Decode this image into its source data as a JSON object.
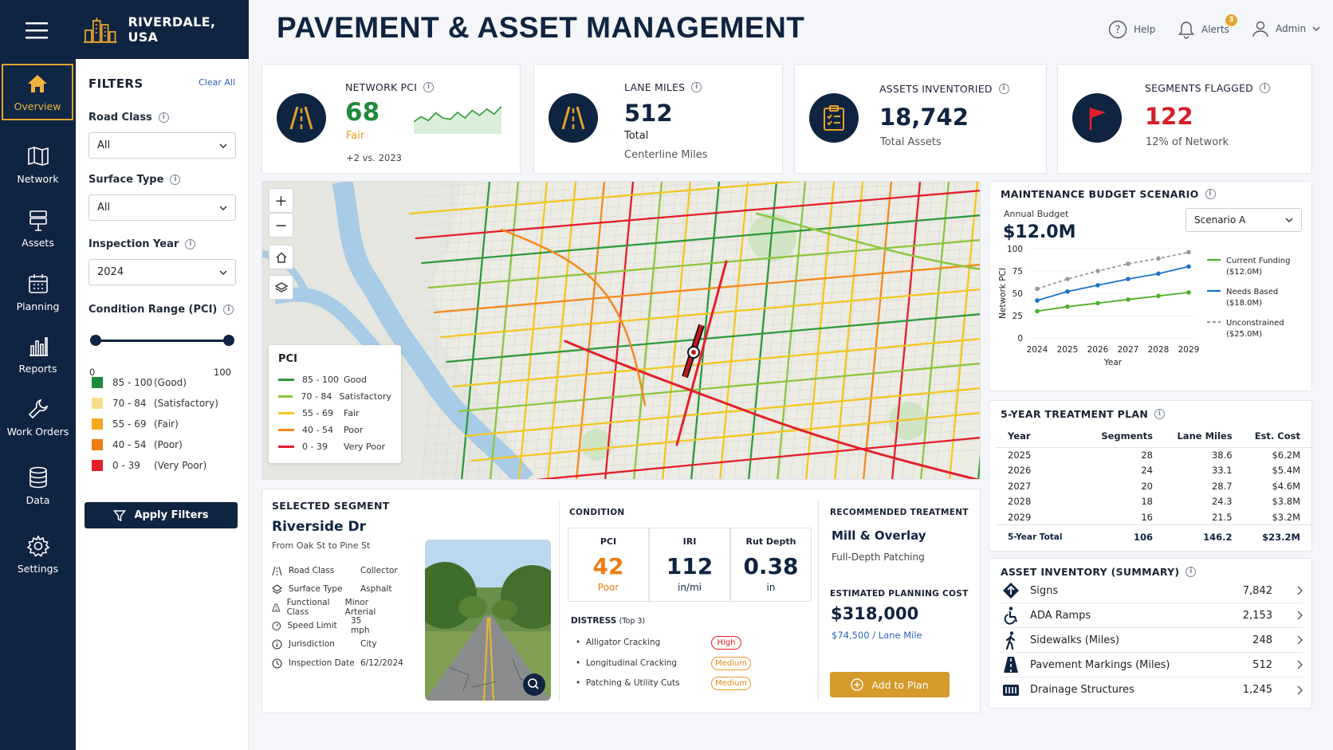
{
  "app": {
    "city": "RIVERDALE, USA",
    "title": "PAVEMENT & ASSET MANAGEMENT"
  },
  "topbar": {
    "help": "Help",
    "alerts": "Alerts",
    "alerts_count": "3",
    "user": "Admin"
  },
  "nav": [
    {
      "label": "Overview",
      "icon": "home-icon",
      "active": true
    },
    {
      "label": "Network",
      "icon": "map-icon"
    },
    {
      "label": "Assets",
      "icon": "road-sign-icon"
    },
    {
      "label": "Planning",
      "icon": "calendar-icon"
    },
    {
      "label": "Reports",
      "icon": "bar-chart-icon"
    },
    {
      "label": "Work Orders",
      "icon": "wrench-icon"
    },
    {
      "label": "Data",
      "icon": "database-icon"
    },
    {
      "label": "Settings",
      "icon": "gear-icon"
    }
  ],
  "filters": {
    "title": "FILTERS",
    "clear": "Clear All",
    "road_class": {
      "label": "Road Class",
      "value": "All"
    },
    "surface_type": {
      "label": "Surface Type",
      "value": "All"
    },
    "inspection_year": {
      "label": "Inspection Year",
      "value": "2024"
    },
    "condition_range": {
      "label": "Condition Range (PCI)",
      "min": "0",
      "max": "100"
    },
    "legend": [
      {
        "range": "85 - 100",
        "label": "(Good)",
        "color": "#1e8a3a"
      },
      {
        "range": "70 - 84",
        "label": "(Satisfactory)",
        "color": "#f7dd8a"
      },
      {
        "range": "55 - 69",
        "label": "(Fair)",
        "color": "#f2a91e"
      },
      {
        "range": "40 - 54",
        "label": "(Poor)",
        "color": "#ec7d14"
      },
      {
        "range": "0 - 39",
        "label": "(Very Poor)",
        "color": "#e3202a"
      }
    ],
    "apply": "Apply Filters"
  },
  "kpis": {
    "pci": {
      "label": "NETWORK PCI",
      "value": "68",
      "sub": "Fair",
      "foot": "+2 vs. 2023",
      "trend": [
        0.35,
        0.55,
        0.4,
        0.7,
        0.5,
        0.45,
        0.72,
        0.5,
        0.8,
        0.6,
        0.85,
        0.65,
        0.95
      ]
    },
    "lane": {
      "label": "LANE MILES",
      "value": "512",
      "sub": "Total",
      "foot": "Centerline Miles"
    },
    "assets": {
      "label": "ASSETS INVENTORIED",
      "value": "18,742",
      "sub": "Total Assets"
    },
    "flagged": {
      "label": "SEGMENTS FLAGGED",
      "value": "122",
      "sub": "12% of Network"
    }
  },
  "map": {
    "legend_title": "PCI",
    "legend": [
      {
        "range": "85 - 100",
        "label": "Good",
        "color": "#2e9a3a"
      },
      {
        "range": "70 - 84",
        "label": "Satisfactory",
        "color": "#8cc63f"
      },
      {
        "range": "55 - 69",
        "label": "Fair",
        "color": "#f3c623"
      },
      {
        "range": "40 - 54",
        "label": "Poor",
        "color": "#f28a1e"
      },
      {
        "range": "0 - 39",
        "label": "Very Poor",
        "color": "#e3202a"
      }
    ]
  },
  "segment": {
    "title": "SELECTED SEGMENT",
    "name": "Riverside Dr",
    "span": "From Oak St to Pine St",
    "attrs": [
      {
        "k": "Road Class",
        "v": "Collector",
        "icon": "road-icon"
      },
      {
        "k": "Surface Type",
        "v": "Asphalt",
        "icon": "layers-icon"
      },
      {
        "k": "Functional Class",
        "v": "Minor Arterial",
        "icon": "road-icon"
      },
      {
        "k": "Speed Limit",
        "v": "35 mph",
        "icon": "speedometer-icon"
      },
      {
        "k": "Jurisdiction",
        "v": "City",
        "icon": "info-icon"
      },
      {
        "k": "Inspection Date",
        "v": "6/12/2024",
        "icon": "clock-icon"
      }
    ],
    "condition_title": "CONDITION",
    "pci": {
      "t": "PCI",
      "v": "42",
      "u": "Poor"
    },
    "iri": {
      "t": "IRI",
      "v": "112",
      "u": "in/mi"
    },
    "rut": {
      "t": "Rut Depth",
      "v": "0.38",
      "u": "in"
    },
    "distress_title": "DISTRESS",
    "distress_note": "(Top 3)",
    "distress": [
      {
        "name": "Alligator Cracking",
        "sev": "High"
      },
      {
        "name": "Longitudinal Cracking",
        "sev": "Medium"
      },
      {
        "name": "Patching & Utility Cuts",
        "sev": "Medium"
      }
    ],
    "rec_title": "RECOMMENDED TREATMENT",
    "rec_primary": "Mill & Overlay",
    "rec_alt": "Full-Depth Patching",
    "cost_title": "ESTIMATED PLANNING COST",
    "cost": "$318,000",
    "cost_per": "$74,500 / Lane Mile",
    "add": "Add to Plan"
  },
  "budget": {
    "title": "MAINTENANCE BUDGET SCENARIO",
    "annual_label": "Annual Budget",
    "annual": "$12.0M",
    "scenario": "Scenario A"
  },
  "chart_data": {
    "type": "line",
    "x": [
      2024,
      2025,
      2026,
      2027,
      2028,
      2029
    ],
    "xlabel": "Year",
    "ylabel": "Network PCI",
    "ylim": [
      0,
      100
    ],
    "yticks": [
      0,
      25,
      50,
      75,
      100
    ],
    "legend_position": "right",
    "series": [
      {
        "name": "Current Funding ($12.0M)",
        "legend_lines": [
          "Current Funding",
          "($12.0M)"
        ],
        "color": "#4caf28",
        "dashed": false,
        "values": [
          30,
          35,
          39,
          43,
          47,
          51
        ]
      },
      {
        "name": "Needs Based ($18.0M)",
        "legend_lines": [
          "Needs Based",
          "($18.0M)"
        ],
        "color": "#1f73c8",
        "dashed": false,
        "values": [
          42,
          52,
          59,
          66,
          72,
          80
        ]
      },
      {
        "name": "Unconstrained ($25.0M)",
        "legend_lines": [
          "Unconstrained",
          "($25.0M)"
        ],
        "color": "#9a9a9a",
        "dashed": true,
        "values": [
          55,
          66,
          75,
          83,
          89,
          96
        ]
      }
    ]
  },
  "plan": {
    "title": "5-YEAR TREATMENT PLAN",
    "headers": [
      "Year",
      "Segments",
      "Lane Miles",
      "Est. Cost"
    ],
    "rows": [
      [
        "2025",
        "28",
        "38.6",
        "$6.2M"
      ],
      [
        "2026",
        "24",
        "33.1",
        "$5.4M"
      ],
      [
        "2027",
        "20",
        "28.7",
        "$4.6M"
      ],
      [
        "2028",
        "18",
        "24.3",
        "$3.8M"
      ],
      [
        "2029",
        "16",
        "21.5",
        "$3.2M"
      ]
    ],
    "total": [
      "5-Year Total",
      "106",
      "146.2",
      "$23.2M"
    ]
  },
  "inventory": {
    "title": "ASSET INVENTORY (SUMMARY)",
    "items": [
      {
        "name": "Signs",
        "count": "7,842",
        "icon": "sign-icon"
      },
      {
        "name": "ADA Ramps",
        "count": "2,153",
        "icon": "wheelchair-icon"
      },
      {
        "name": "Sidewalks (Miles)",
        "count": "248",
        "icon": "pedestrian-icon"
      },
      {
        "name": "Pavement Markings (Miles)",
        "count": "512",
        "icon": "road-marking-icon"
      },
      {
        "name": "Drainage Structures",
        "count": "1,245",
        "icon": "drain-icon"
      }
    ]
  }
}
